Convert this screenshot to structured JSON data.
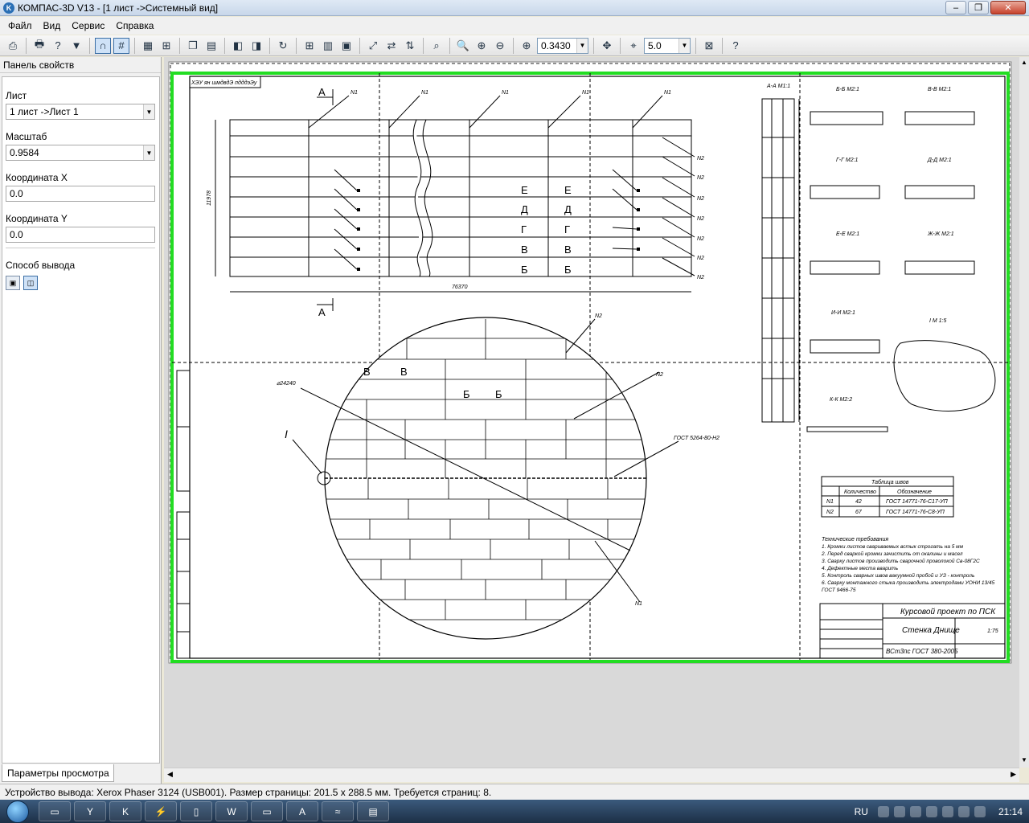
{
  "window": {
    "title": "КОМПАС-3D V13 - [1 лист ->Системный вид]",
    "app_icon": "K"
  },
  "menu": [
    "Файл",
    "Вид",
    "Сервис",
    "Справка"
  ],
  "toolbar": {
    "zoom_value": "0.3430",
    "step_value": "5.0"
  },
  "panel": {
    "title": "Панель свойств",
    "sheet_label": "Лист",
    "sheet_value": "1 лист ->Лист 1",
    "scale_label": "Масштаб",
    "scale_value": "0.9584",
    "x_label": "Координата X",
    "x_value": "0.0",
    "y_label": "Координата Y",
    "y_value": "0.0",
    "output_label": "Способ вывода",
    "tab_label": "Параметры просмотра"
  },
  "status": {
    "text": "Устройство вывода: Xerox Phaser 3124 (USB001). Размер страницы: 201.5 x 288.5 мм. Требуется страниц: 8."
  },
  "taskbar": {
    "lang": "RU",
    "time": "21:14"
  },
  "drawing": {
    "corner_label": "ХЭУ ян шмдвдЭ пдддэЭу",
    "section_aa": "А-А М1:1",
    "sections": [
      "Б-Б М2:1",
      "В-В М2:1",
      "Г-Г М2:1",
      "Д-Д М2:1",
      "Е-Е М2:1",
      "Ж-Ж М2:1",
      "И-И М2:1",
      "К-К М2:2",
      "I  М 1:5"
    ],
    "cut_letters": [
      "Е",
      "Д",
      "Г",
      "В",
      "Б"
    ],
    "weld_labels": [
      "N1",
      "N2"
    ],
    "dim_total": "76370",
    "dim_height": "11978",
    "diameter": "⌀24240",
    "gost_note": "ГОСТ 5264-80-Н2",
    "table_title": "Таблица швов",
    "table_headers": [
      "Количество",
      "Обозначение"
    ],
    "table_rows": [
      [
        "N1",
        "42",
        "ГОСТ 14771-76-С17-УП"
      ],
      [
        "N2",
        "67",
        "ГОСТ 14771-76-С8-УП"
      ]
    ],
    "tech_title": "Технические требования",
    "tech_lines": [
      "1. Кромки листов свариваемых встык строгать на 5 мм",
      "2. Перед сваркой кромки зачистить от окалины и масел",
      "3. Сварку листов производить сварочной проволокой Св-08Г2С",
      "4. Дефектные места вварить",
      "5. Контроль сварных швов вакуумной пробой и УЗ - контроль",
      "6. Сварку монтажного стыка производить электродами УОНИ 13/45",
      "ГОСТ 9466-75"
    ],
    "stamp_project": "Курсовой проект по ПСК",
    "stamp_name": "Стенка Днище",
    "stamp_material": "ВСт3пс ГОСТ 380-2005",
    "stamp_mass": "1:75",
    "callout_I": "I"
  }
}
